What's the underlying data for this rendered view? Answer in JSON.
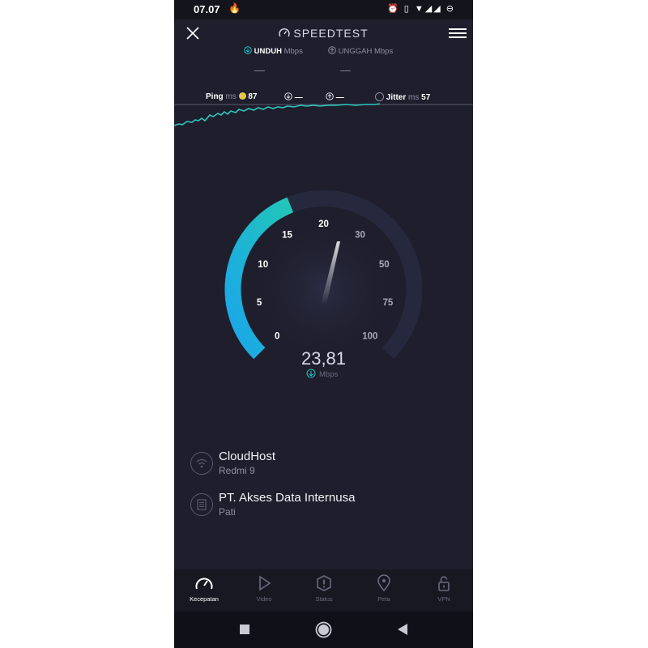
{
  "status_bar": {
    "time": "07.07",
    "flame_icon": "🔥",
    "icons": "⏰ ▯ ▼◢◢ ⊖"
  },
  "header": {
    "title": "SPEEDTEST"
  },
  "download": {
    "label": "UNDUH",
    "unit": "Mbps",
    "value": "—"
  },
  "upload": {
    "label": "UNGGAH",
    "unit": "Mbps",
    "value": "—"
  },
  "metrics": {
    "ping_label": "Ping",
    "ping_unit": "ms",
    "ping_value": "87",
    "download_ping_value": "—",
    "upload_ping_value": "—",
    "jitter_label": "Jitter",
    "jitter_unit": "ms",
    "jitter_value": "57"
  },
  "gauge": {
    "scale_labels": [
      "0",
      "5",
      "10",
      "15",
      "20",
      "30",
      "50",
      "75",
      "100"
    ],
    "reading": "23,81",
    "unit": "Mbps",
    "progress": 0.42
  },
  "server": {
    "host": "CloudHost",
    "device": "Redmi 9"
  },
  "provider": {
    "name": "PT. Akses Data Internusa",
    "location": "Pati"
  },
  "tabs": [
    {
      "label": "Kecepatan",
      "icon": "speed-icon",
      "active": true
    },
    {
      "label": "Video",
      "icon": "play-icon",
      "active": false
    },
    {
      "label": "Status",
      "icon": "alert-icon",
      "active": false
    },
    {
      "label": "Peta",
      "icon": "map-pin-icon",
      "active": false
    },
    {
      "label": "VPN",
      "icon": "lock-icon",
      "active": false
    }
  ],
  "colors": {
    "accent": "#1fc4c0",
    "background": "#1e1e2c",
    "gauge_track": "#26293e"
  }
}
